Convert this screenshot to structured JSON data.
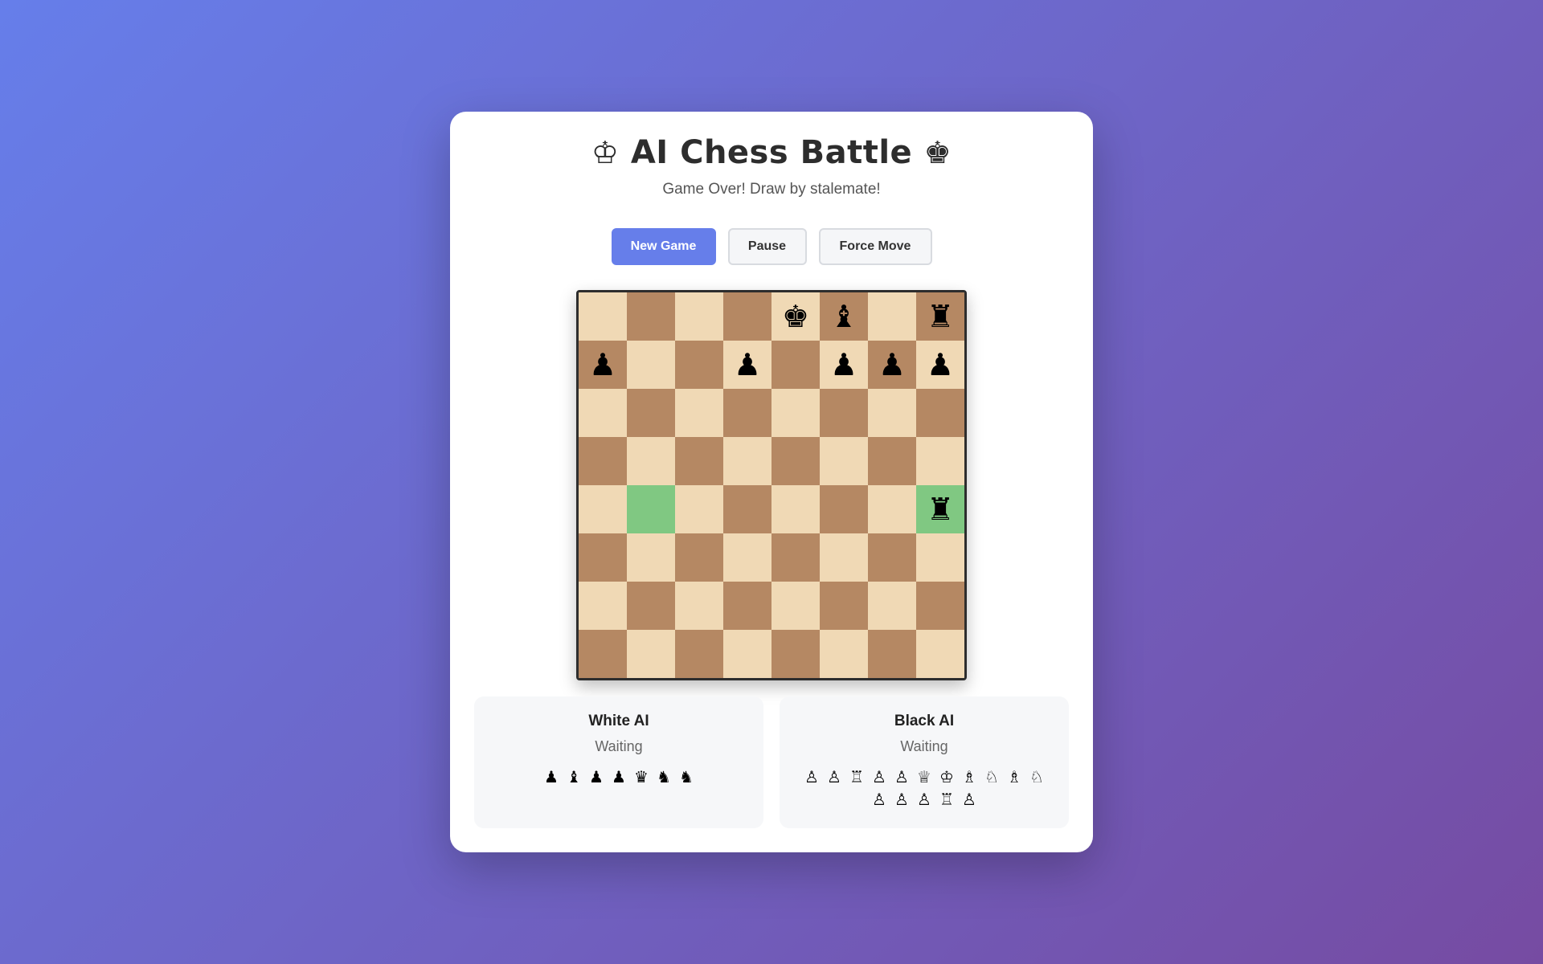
{
  "header": {
    "icon_left": "♔",
    "title": "AI Chess Battle",
    "icon_right": "♚",
    "status": "Game Over! Draw by stalemate!"
  },
  "controls": {
    "new_game": "New Game",
    "pause": "Pause",
    "force_move": "Force Move"
  },
  "colors": {
    "light_square": "#f0d9b5",
    "dark_square": "#b58863",
    "highlight": "#80c882",
    "accent": "#667eea"
  },
  "board": {
    "ranks": [
      [
        "",
        "",
        "",
        "",
        "♚",
        "♝",
        "",
        "♜"
      ],
      [
        "♟",
        "",
        "",
        "♟",
        "",
        "♟",
        "♟",
        "♟"
      ],
      [
        "",
        "",
        "",
        "",
        "",
        "",
        "",
        ""
      ],
      [
        "",
        "",
        "",
        "",
        "",
        "",
        "",
        ""
      ],
      [
        "",
        "",
        "",
        "",
        "",
        "",
        "",
        "♜"
      ],
      [
        "",
        "",
        "",
        "",
        "",
        "",
        "",
        ""
      ],
      [
        "",
        "",
        "",
        "",
        "",
        "",
        "",
        ""
      ],
      [
        "",
        "",
        "",
        "",
        "",
        "",
        "",
        ""
      ]
    ],
    "highlighted": [
      [
        4,
        1
      ],
      [
        4,
        7
      ]
    ]
  },
  "players": {
    "white": {
      "name": "White AI",
      "status": "Waiting",
      "captured": [
        "♟",
        "♝",
        "♟",
        "♟",
        "♛",
        "♞",
        "♞"
      ]
    },
    "black": {
      "name": "Black AI",
      "status": "Waiting",
      "captured": [
        "♙",
        "♙",
        "♖",
        "♙",
        "♙",
        "♕",
        "♔",
        "♗",
        "♘",
        "♗",
        "♘",
        "♙",
        "♙",
        "♙",
        "♖",
        "♙"
      ]
    }
  }
}
